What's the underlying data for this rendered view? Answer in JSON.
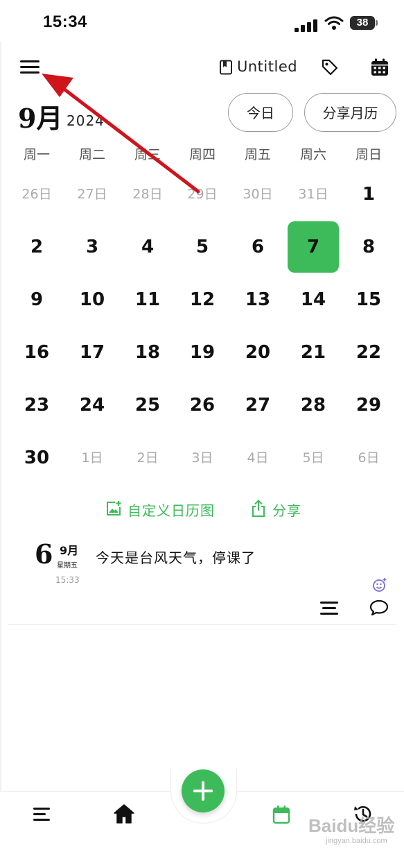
{
  "status": {
    "time": "15:34",
    "battery": "38"
  },
  "header": {
    "notebook_name": "Untitled"
  },
  "calendar": {
    "month": "9月",
    "year": "2024",
    "today_label": "今日",
    "share_month_label": "分享月历",
    "weekdays": [
      "周一",
      "周二",
      "周三",
      "周四",
      "周五",
      "周六",
      "周日"
    ],
    "days": [
      "26日",
      "27日",
      "28日",
      "29日",
      "30日",
      "31日",
      "1",
      "2",
      "3",
      "4",
      "5",
      "6",
      "7",
      "8",
      "9",
      "10",
      "11",
      "12",
      "13",
      "14",
      "15",
      "16",
      "17",
      "18",
      "19",
      "20",
      "21",
      "22",
      "23",
      "24",
      "25",
      "26",
      "27",
      "28",
      "29",
      "30",
      "1日",
      "2日",
      "3日",
      "4日",
      "5日",
      "6日"
    ],
    "selected_day": "6"
  },
  "actions": {
    "custom_image_label": "自定义日历图",
    "share_label": "分享"
  },
  "entry": {
    "day": "6",
    "month": "9月",
    "weekday": "星期五",
    "time": "15:33",
    "text": "今天是台风天气，停课了"
  },
  "watermark": {
    "brand": "Baidu经验",
    "site": "jingyan.baidu.com"
  },
  "colors": {
    "accent": "#3dbb5a",
    "annotation_arrow": "#d0141c"
  }
}
